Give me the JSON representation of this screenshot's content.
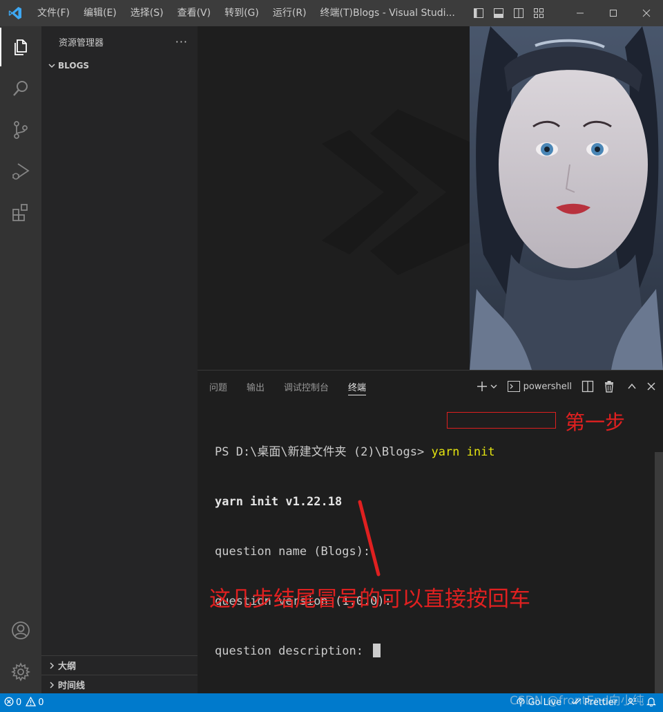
{
  "titlebar": {
    "menu": [
      "文件(F)",
      "编辑(E)",
      "选择(S)",
      "查看(V)",
      "转到(G)",
      "运行(R)",
      "终端(T)"
    ],
    "window_title": "Blogs - Visual Studi..."
  },
  "sidebar": {
    "title": "资源管理器",
    "more": "···",
    "folder": "BLOGS",
    "outline": "大纲",
    "timeline": "时间线"
  },
  "panel": {
    "tabs": [
      "问题",
      "输出",
      "调试控制台",
      "终端"
    ],
    "active_tab": "终端",
    "shell": "powershell"
  },
  "terminal": {
    "prompt": "PS D:\\桌面\\新建文件夹 (2)\\Blogs> ",
    "command": "yarn init",
    "line2": "yarn init v1.22.18",
    "line3": "question name (Blogs):",
    "line4": "question version (1.0.0):",
    "line5": "question description: "
  },
  "annotations": {
    "step": "第一步",
    "note": "这几步结尾冒号的可以直接按回车",
    "color": "#e02020"
  },
  "statusbar": {
    "errors": "0",
    "warnings": "0",
    "go_live": "Go Live",
    "prettier": "Prettier"
  },
  "watermark": "CSDN @frontEnd向小纯",
  "colors": {
    "accent": "#007acc",
    "titlebar": "#3c3c3c",
    "activitybar": "#333333",
    "sidebar": "#252526",
    "editor": "#1e1e1e"
  }
}
